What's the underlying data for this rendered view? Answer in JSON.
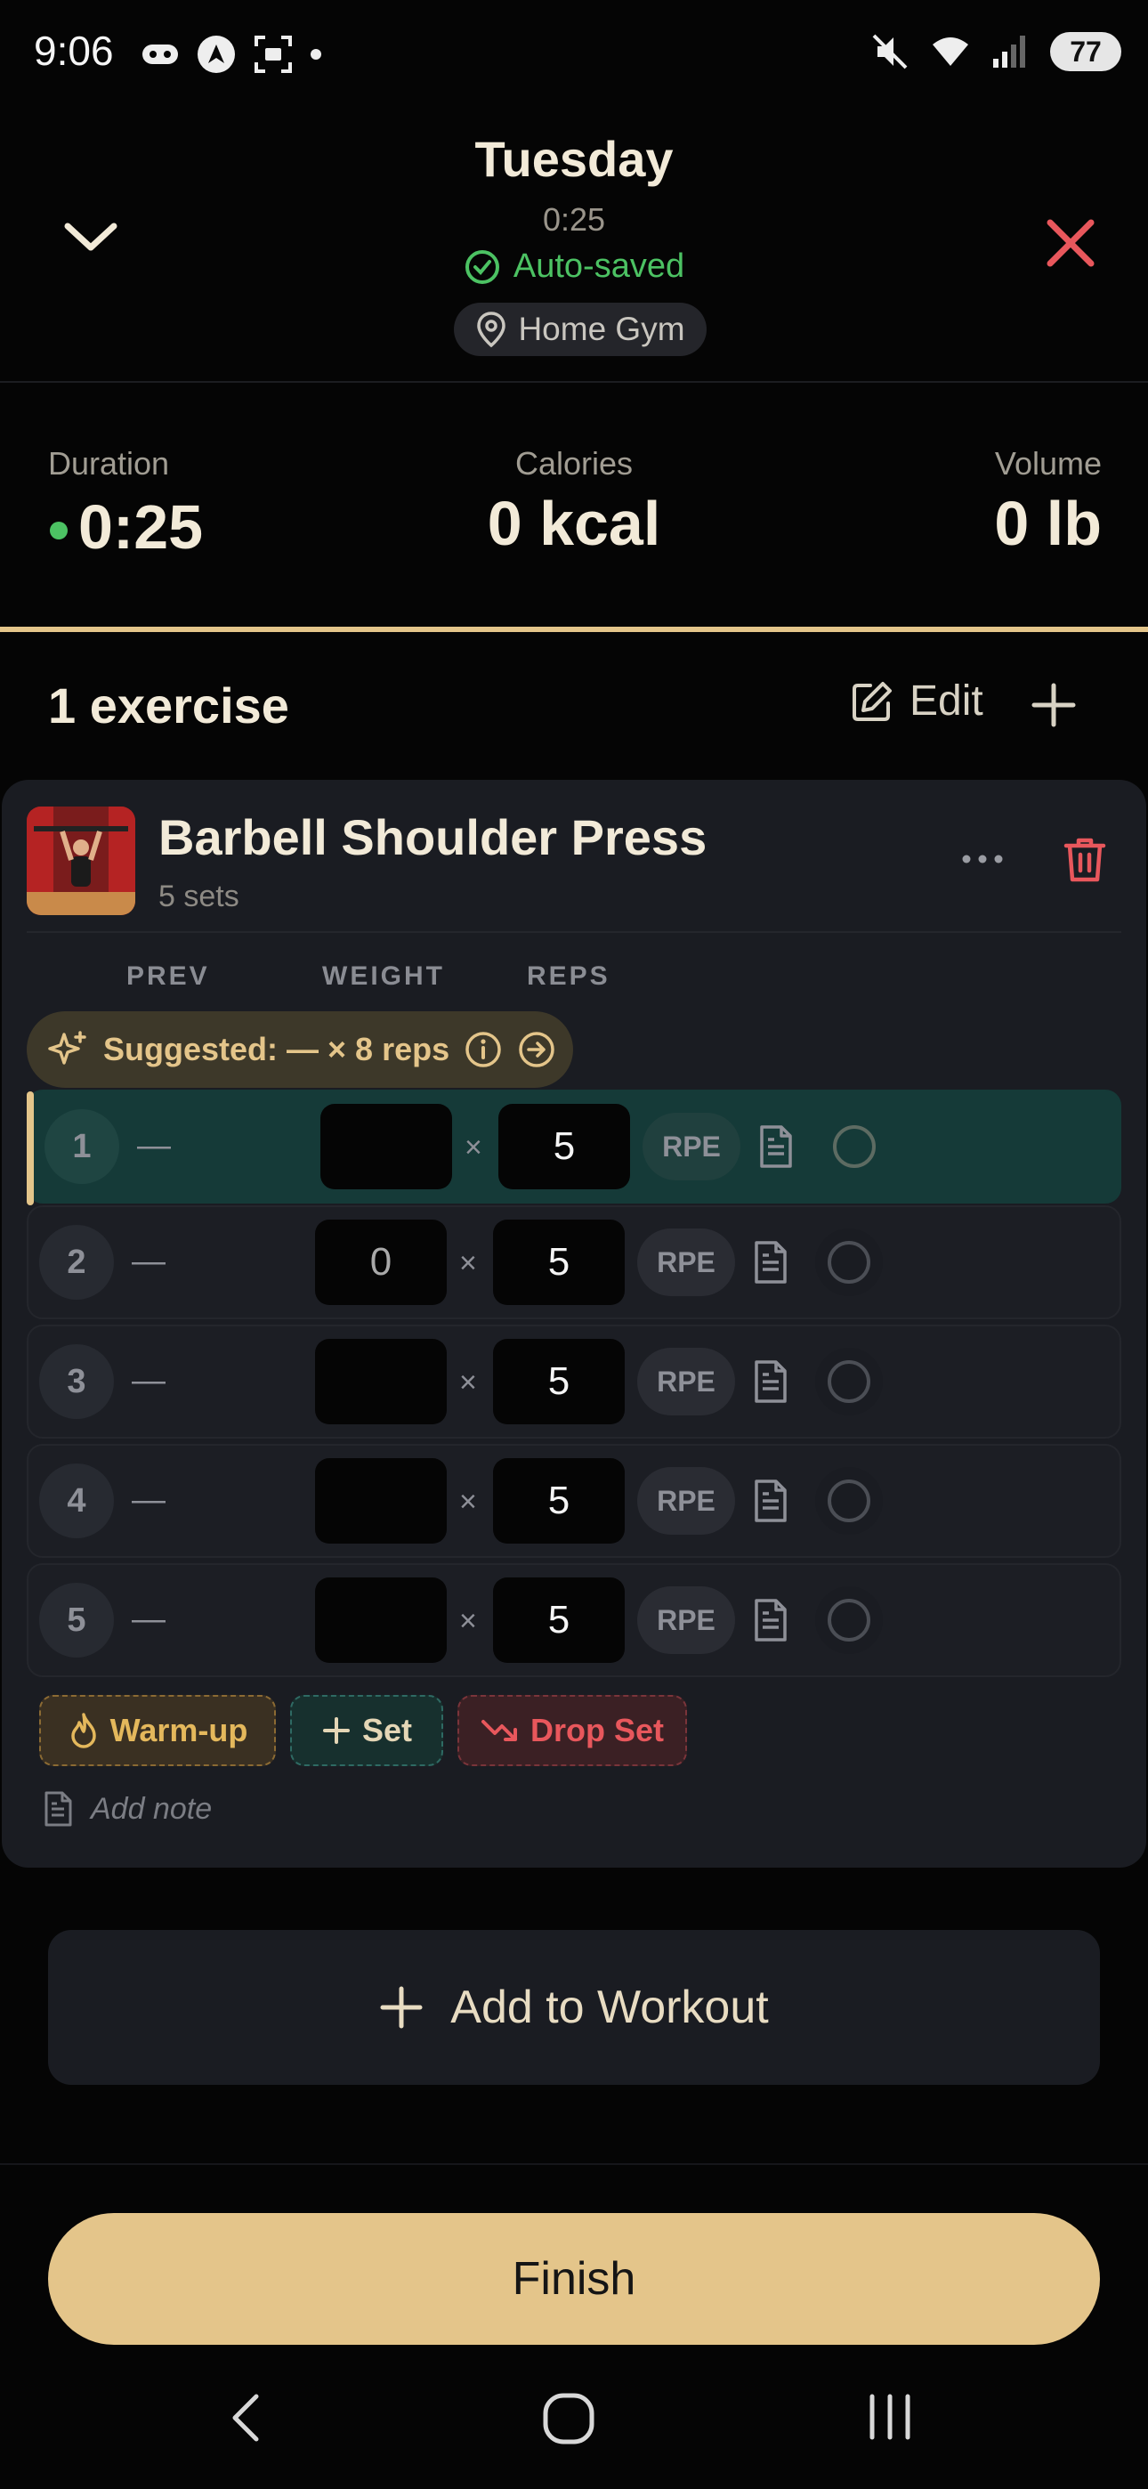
{
  "status_bar": {
    "time": "9:06",
    "battery": "77"
  },
  "header": {
    "title": "Tuesday",
    "timer": "0:25",
    "save_status": "Auto-saved",
    "location": "Home Gym"
  },
  "stats": {
    "duration_label": "Duration",
    "duration_value": "0:25",
    "calories_label": "Calories",
    "calories_value": "0 kcal",
    "volume_label": "Volume",
    "volume_value": "0 lb"
  },
  "exercises_header": {
    "count_label": "1 exercise",
    "edit_label": "Edit"
  },
  "exercise": {
    "name": "Barbell Shoulder Press",
    "sets_label": "5 sets",
    "columns": {
      "prev": "PREV",
      "weight": "WEIGHT",
      "reps": "REPS"
    },
    "suggestion": "Suggested: — × 8 reps",
    "sets": [
      {
        "num": "1",
        "prev": "—",
        "weight": "",
        "times": "×",
        "reps": "5",
        "rpe": "RPE",
        "active": true
      },
      {
        "num": "2",
        "prev": "—",
        "weight": "0",
        "times": "×",
        "reps": "5",
        "rpe": "RPE",
        "active": false
      },
      {
        "num": "3",
        "prev": "—",
        "weight": "",
        "times": "×",
        "reps": "5",
        "rpe": "RPE",
        "active": false
      },
      {
        "num": "4",
        "prev": "—",
        "weight": "",
        "times": "×",
        "reps": "5",
        "rpe": "RPE",
        "active": false
      },
      {
        "num": "5",
        "prev": "—",
        "weight": "",
        "times": "×",
        "reps": "5",
        "rpe": "RPE",
        "active": false
      }
    ],
    "actions": {
      "warmup": "Warm-up",
      "add_set": "Set",
      "drop_set": "Drop Set"
    },
    "add_note_placeholder": "Add note"
  },
  "add_to_workout_label": "Add to Workout",
  "finish_label": "Finish",
  "colors": {
    "accent_gold": "#e4c58a",
    "success_green": "#4cc263",
    "danger_red": "#e8575c",
    "active_row": "#153a38",
    "card_bg": "#1a1c22"
  },
  "icons": {
    "status": [
      "gamepad-icon",
      "android-auto-icon",
      "screenshot-icon",
      "dot-icon",
      "mute-icon",
      "wifi-icon",
      "signal-icon"
    ],
    "header": [
      "chevron-down-icon",
      "close-icon",
      "check-circle-icon",
      "location-pin-icon"
    ],
    "exercise": [
      "more-horizontal-icon",
      "trash-icon",
      "sparkles-icon",
      "info-icon",
      "arrow-right-circle-icon",
      "note-icon",
      "empty-circle-icon",
      "flame-icon",
      "plus-icon",
      "trend-down-icon"
    ],
    "nav": [
      "nav-back-icon",
      "nav-home-icon",
      "nav-recents-icon"
    ]
  }
}
